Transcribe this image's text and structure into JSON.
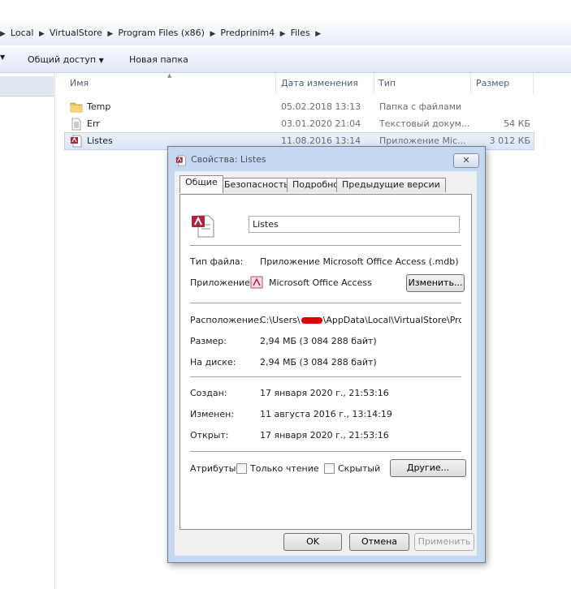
{
  "address_bar": {
    "crumbs": [
      "Local",
      "VirtualStore",
      "Program Files (x86)",
      "Predprinim4",
      "Files"
    ]
  },
  "toolbar": {
    "share_label": "Общий доступ",
    "new_folder_label": "Новая папка"
  },
  "columns": {
    "name": "Имя",
    "date": "Дата изменения",
    "type": "Тип",
    "size": "Размер"
  },
  "files": [
    {
      "name": "Temp",
      "date": "05.02.2018 13:13",
      "type": "Папка с файлами",
      "size": "",
      "icon": "folder-icon"
    },
    {
      "name": "Err",
      "date": "03.01.2020 21:04",
      "type": "Текстовый докум...",
      "size": "54 КБ",
      "icon": "text-file-icon"
    },
    {
      "name": "Listes",
      "date": "11.08.2016 13:14",
      "type": "Приложение Mic...",
      "size": "3 012 КБ",
      "icon": "access-file-icon"
    }
  ],
  "dialog": {
    "title": "Свойства: Listes",
    "tabs": [
      "Общие",
      "Безопасность",
      "Подробно",
      "Предыдущие версии"
    ],
    "file_name": "Listes",
    "file_type_label": "Тип файла:",
    "file_type_value": "Приложение Microsoft Office Access (.mdb)",
    "app_label": "Приложение:",
    "app_value": "Microsoft Office Access",
    "change_button": "Изменить...",
    "location_label": "Расположение:",
    "location_prefix": "C:\\Users\\",
    "location_suffix": "\\AppData\\Local\\VirtualStore\\Progra",
    "size_label": "Размер:",
    "size_value": "2,94 МБ (3 084 288 байт)",
    "disk_label": "На диске:",
    "disk_value": "2,94 МБ (3 084 288 байт)",
    "created_label": "Создан:",
    "created_value": "17 января 2020 г., 21:53:16",
    "modified_label": "Изменен:",
    "modified_value": "11 августа 2016 г., 13:14:19",
    "opened_label": "Открыт:",
    "opened_value": "17 января 2020 г., 21:53:16",
    "attributes_label": "Атрибуты:",
    "readonly_label": "Только чтение",
    "hidden_label": "Скрытый",
    "other_button": "Другие...",
    "ok_button": "OK",
    "cancel_button": "Отмена",
    "apply_button": "Применить"
  },
  "colors": {
    "dialog_frame": "#c6d8ef",
    "access_red": "#b0243c",
    "folder_yellow": "#e8c25a"
  }
}
